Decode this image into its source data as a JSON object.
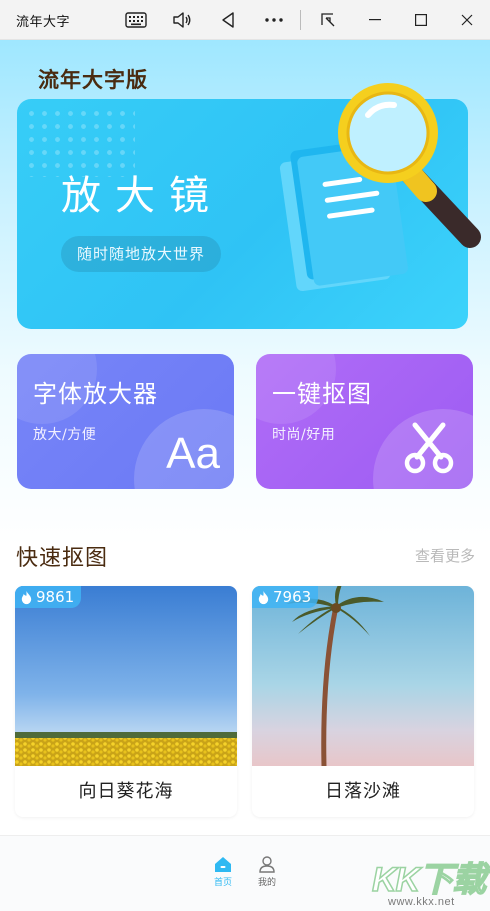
{
  "window": {
    "title": "流年大字",
    "icons": [
      "keyboard-icon",
      "volume-icon",
      "back-triangle-icon",
      "more-icon",
      "snap-icon",
      "minimize-icon",
      "maximize-icon",
      "close-icon"
    ]
  },
  "app": {
    "title": "流年大字版"
  },
  "hero": {
    "title": "放大镜",
    "subtitle": "随时随地放大世界"
  },
  "features": [
    {
      "title": "字体放大器",
      "subtitle": "放大/方便",
      "glyph": "Aa",
      "icon": "font-size-icon"
    },
    {
      "title": "一键抠图",
      "subtitle": "时尚/好用",
      "icon": "scissors-icon"
    }
  ],
  "quick_section": {
    "title": "快速抠图",
    "more": "查看更多",
    "items": [
      {
        "hot": "9861",
        "label": "向日葵花海",
        "icon": "flame-icon"
      },
      {
        "hot": "7963",
        "label": "日落沙滩",
        "icon": "flame-icon"
      }
    ]
  },
  "nav": {
    "items": [
      {
        "label": "首页",
        "icon": "home-icon",
        "active": true
      },
      {
        "label": "我的",
        "icon": "user-icon",
        "active": false
      }
    ]
  },
  "watermark": {
    "brand": "KK下载",
    "url": "www.kkx.net"
  },
  "colors": {
    "accent": "#2fb9f2",
    "hero_bg": "#37cdf7",
    "card_font": "#6f7df6",
    "card_cut": "#a664f5",
    "title_brown": "#4a2b10"
  }
}
